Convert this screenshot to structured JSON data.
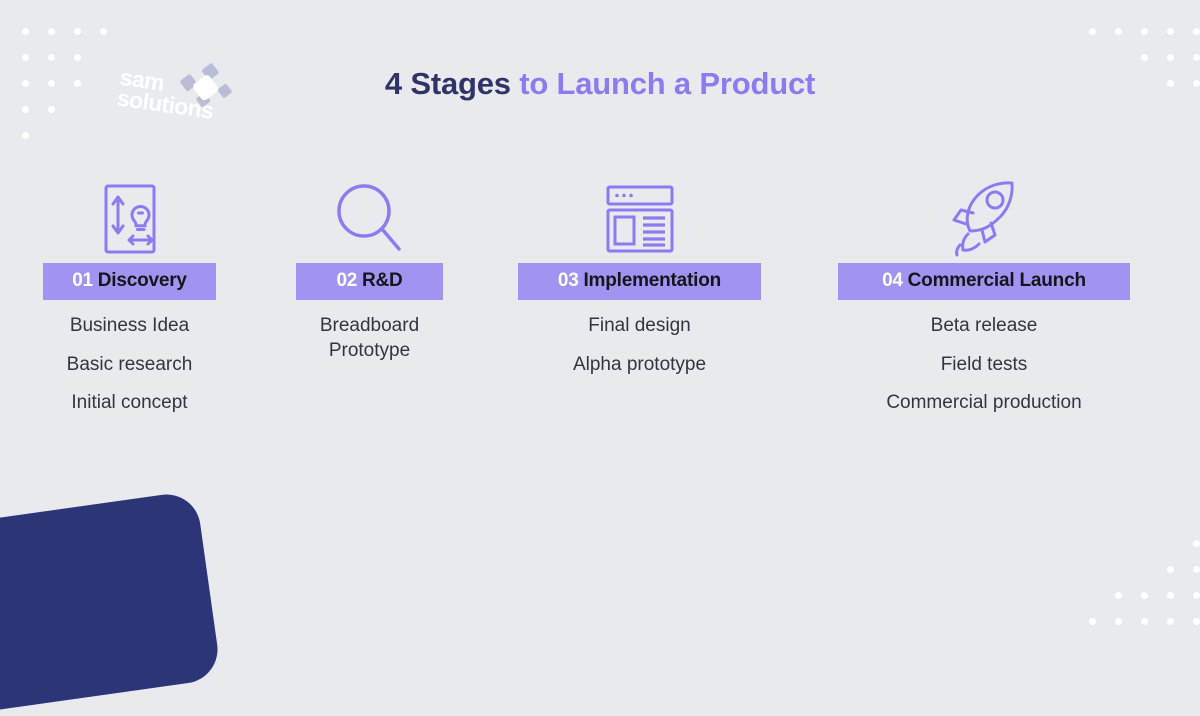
{
  "background_color": "#e9eaee",
  "accent_color": "#a193f2",
  "title_dark_color": "#2f3468",
  "brand_color": "#2c3578",
  "title": {
    "part_dark": "4 Stages",
    "part_accent": " to Launch a Product"
  },
  "stages": [
    {
      "number": "01",
      "label": "Discovery",
      "icon": "document-lightbulb-icon",
      "items": [
        "Business Idea",
        "Basic research",
        "Initial concept"
      ]
    },
    {
      "number": "02",
      "label": "R&D",
      "icon": "magnifying-glass-icon",
      "items": [
        "Breadboard\nPrototype"
      ]
    },
    {
      "number": "03",
      "label": "Implementation",
      "icon": "webpage-wireframe-icon",
      "items": [
        "Final design",
        "Alpha prototype"
      ]
    },
    {
      "number": "04",
      "label": "Commercial Launch",
      "icon": "rocket-icon",
      "items": [
        "Beta release",
        "Field tests",
        "Commercial production"
      ]
    }
  ],
  "logo": {
    "line1": "sam",
    "line2": "solutions"
  },
  "decoration": {
    "dot_color": "#ffffff",
    "top_left_rows": [
      4,
      3,
      3,
      2,
      1
    ],
    "top_right_rows": [
      5,
      3,
      2
    ],
    "bottom_right_rows": [
      1,
      2,
      4,
      5
    ]
  }
}
